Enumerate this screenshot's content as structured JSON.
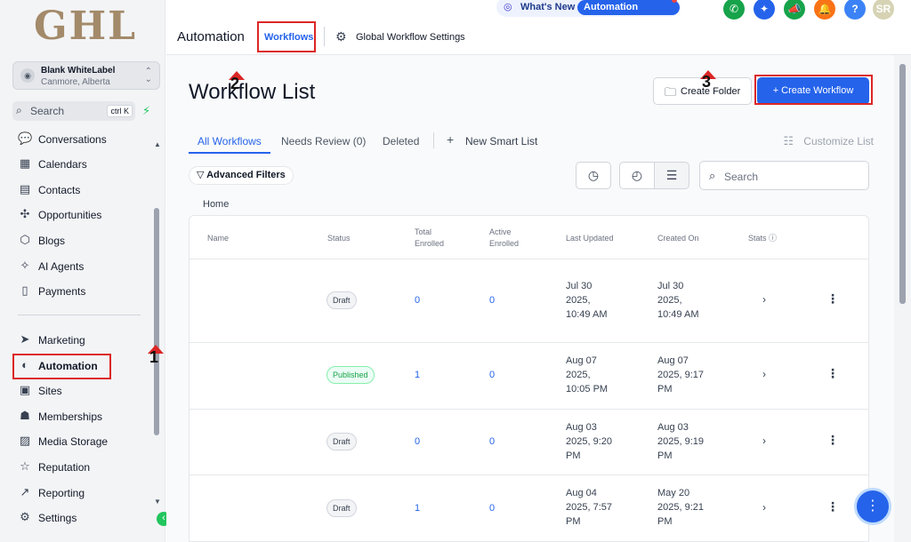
{
  "sidebar": {
    "logo": "GHL",
    "account": {
      "name": "Blank WhiteLabel",
      "location": "Canmore, Alberta"
    },
    "search": {
      "label": "Search",
      "shortcut": "ctrl K"
    },
    "items": [
      {
        "label": "Conversations",
        "icon": "chat-icon"
      },
      {
        "label": "Calendars",
        "icon": "calendar-icon"
      },
      {
        "label": "Contacts",
        "icon": "contacts-icon"
      },
      {
        "label": "Opportunities",
        "icon": "opportunities-icon"
      },
      {
        "label": "Blogs",
        "icon": "blogs-icon"
      },
      {
        "label": "AI Agents",
        "icon": "ai-agents-icon"
      },
      {
        "label": "Payments",
        "icon": "payments-icon"
      },
      {
        "label": "Marketing",
        "icon": "marketing-icon"
      },
      {
        "label": "Automation",
        "icon": "automation-icon"
      },
      {
        "label": "Sites",
        "icon": "sites-icon"
      },
      {
        "label": "Memberships",
        "icon": "memberships-icon"
      },
      {
        "label": "Media Storage",
        "icon": "media-storage-icon"
      },
      {
        "label": "Reputation",
        "icon": "reputation-icon"
      },
      {
        "label": "Reporting",
        "icon": "reporting-icon"
      },
      {
        "label": "Settings",
        "icon": "settings-icon"
      }
    ]
  },
  "topbar": {
    "title": "Automation",
    "tab_workflows": "Workflows",
    "tab_global": "Global Workflow Settings",
    "whats_new": "What's New",
    "updates_badge": "Automation Updates",
    "avatar": "SR",
    "icon_colors": [
      "#16a34a",
      "#2563eb",
      "#16a34a",
      "#f97316",
      "#3b82f6",
      "#d6d3b4"
    ]
  },
  "main": {
    "heading": "Workflow List",
    "create_folder": "Create Folder",
    "create_workflow": "+ Create Workflow",
    "tabs": [
      "All Workflows",
      "Needs Review (0)",
      "Deleted",
      "New Smart List"
    ],
    "customize": "Customize List",
    "advanced_filters": "Advanced Filters",
    "search_placeholder": "Search",
    "breadcrumb": "Home",
    "columns": [
      "Name",
      "Status",
      "Total\nEnrolled",
      "Active\nEnrolled",
      "Last Updated",
      "Created On",
      "Stats"
    ],
    "rows": [
      {
        "name": "",
        "status": "Draft",
        "total": "0",
        "active": "0",
        "updated": "Jul 30\n2025,\n10:49 AM",
        "created": "Jul 30\n2025,\n10:49 AM"
      },
      {
        "name": "",
        "status": "Published",
        "total": "1",
        "active": "0",
        "updated": "Aug 07\n2025,\n10:05 PM",
        "created": "Aug 07\n2025, 9:17\nPM"
      },
      {
        "name": "",
        "status": "Draft",
        "total": "0",
        "active": "0",
        "updated": "Aug 03\n2025, 9:20\nPM",
        "created": "Aug 03\n2025, 9:19\nPM"
      },
      {
        "name": "",
        "status": "Draft",
        "total": "1",
        "active": "0",
        "updated": "Aug 04\n2025, 7:57\nPM",
        "created": "May 20\n2025, 9:21\nPM"
      }
    ]
  },
  "annotations": [
    "1",
    "2",
    "3"
  ]
}
